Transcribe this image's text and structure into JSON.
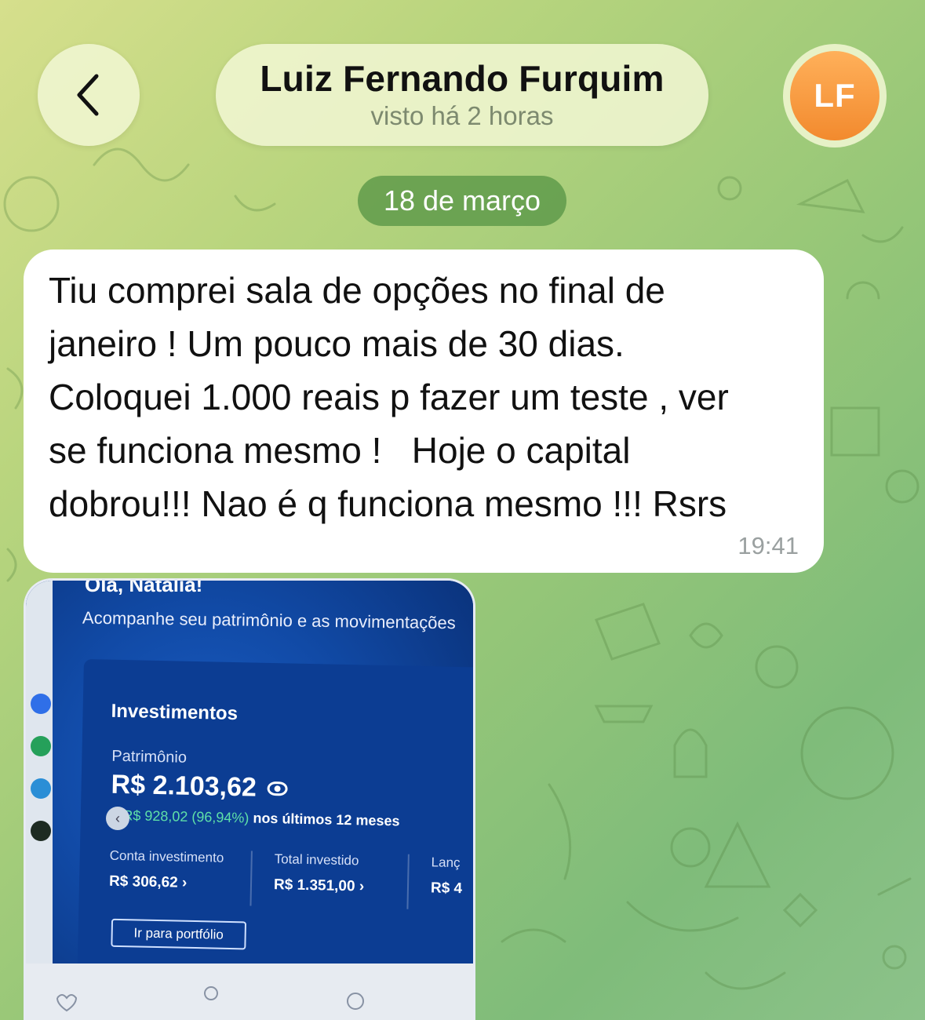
{
  "header": {
    "back_icon": "chevron-left-icon",
    "contact_name": "Luiz Fernando Furquim",
    "last_seen": "visto há 2 horas",
    "avatar_initials": "LF",
    "avatar_color": "#f28a2e"
  },
  "date_separator": "18 de março",
  "messages": [
    {
      "text": "Tiu comprei sala de opções no final de\njaneiro ! Um pouco mais de 30 dias.\nColoquei 1.000 reais p fazer um teste , ver\nse funciona mesmo !   Hoje o capital\ndobrou!!! Nao é q funciona mesmo !!! Rsrs",
      "time": "19:41"
    }
  ],
  "photo": {
    "greeting": "Olá, Natália!",
    "subtitle": "Acompanhe seu patrimônio e as movimentações",
    "card_title": "Investimentos",
    "patrimonio_label": "Patrimônio",
    "patrimonio_value": "R$ 2.103,62",
    "change_green": "+ R$ 928,02 (96,94%)",
    "change_text": "nos últimos 12 meses",
    "col1_label": "Conta investimento",
    "col1_value": "R$ 306,62  ›",
    "col2_label": "Total investido",
    "col2_value": "R$ 1.351,00  ›",
    "col3_label": "Lanç",
    "col3_value": "R$ 4",
    "portfolio_button": "Ir para portfólio",
    "arrow": "‹"
  }
}
